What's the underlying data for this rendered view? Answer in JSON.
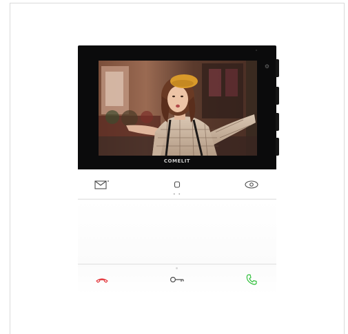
{
  "device": {
    "brand_label": "COMELIT"
  },
  "keys": {
    "top_row": [
      {
        "icon": "envelope-icon"
      },
      {
        "icon": "home-icon"
      },
      {
        "icon": "eye-icon"
      }
    ],
    "bottom_row": [
      {
        "icon": "hang-up-icon",
        "color": "#e3343a"
      },
      {
        "icon": "key-icon",
        "color": "#4a4a4a"
      },
      {
        "icon": "answer-phone-icon",
        "color": "#2fbf3a"
      }
    ]
  },
  "colors": {
    "housing": "#ffffff",
    "monitor": "#0b0b0c",
    "icon_gray": "#4a4a4a"
  }
}
